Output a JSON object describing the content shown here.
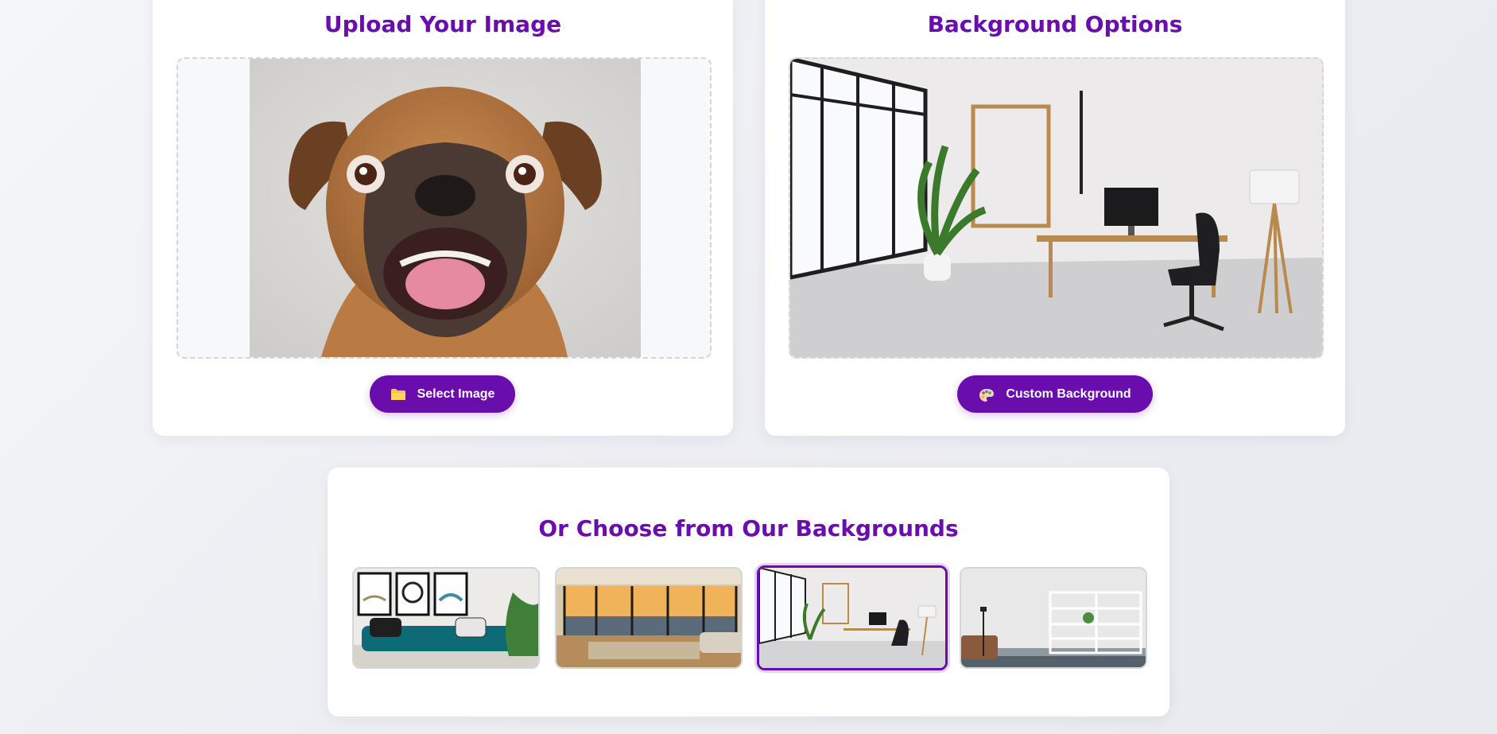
{
  "upload_card": {
    "title": "Upload Your Image",
    "button_label": "Select Image",
    "button_icon": "folder-icon",
    "image_subject": "dog-photo"
  },
  "background_card": {
    "title": "Background Options",
    "button_label": "Custom Background",
    "button_icon": "palette-icon",
    "image_subject": "office-room"
  },
  "gallery": {
    "title": "Or Choose from Our Backgrounds",
    "thumbnails": [
      {
        "subject": "living-room-teal-sofa",
        "selected": false
      },
      {
        "subject": "penthouse-city-view",
        "selected": false
      },
      {
        "subject": "office-room",
        "selected": true
      },
      {
        "subject": "white-room-shelves",
        "selected": false
      }
    ]
  },
  "colors": {
    "accent": "#6a0dad",
    "card": "#ffffff",
    "page": "#eceef3"
  }
}
